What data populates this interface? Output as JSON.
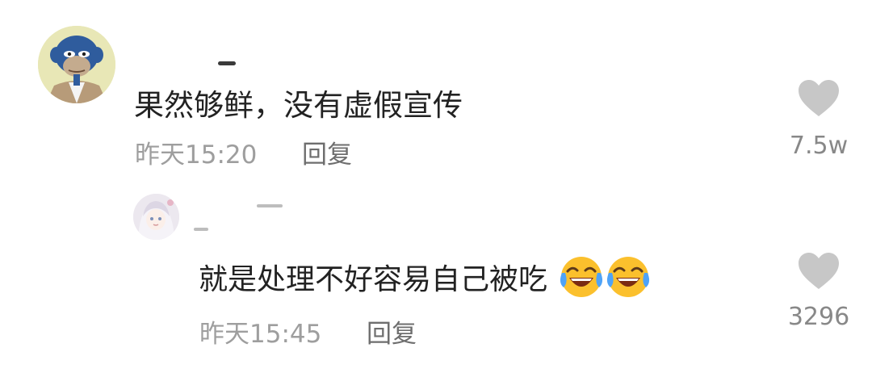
{
  "comments": [
    {
      "text": "果然够鲜，没有虚假宣传",
      "time": "昨天15:20",
      "reply_label": "回复",
      "like_count": "7.5w",
      "avatar_icon": "ape-avatar-icon"
    },
    {
      "text": "就是处理不好容易自己被吃",
      "emojis": [
        "laughing-crying-emoji",
        "laughing-crying-emoji"
      ],
      "time": "昨天15:45",
      "reply_label": "回复",
      "like_count": "3296",
      "avatar_icon": "anime-girl-avatar-icon"
    }
  ],
  "colors": {
    "heart": "#c7c7c7",
    "meta_text": "#9e9e9e",
    "body_text": "#222222"
  }
}
